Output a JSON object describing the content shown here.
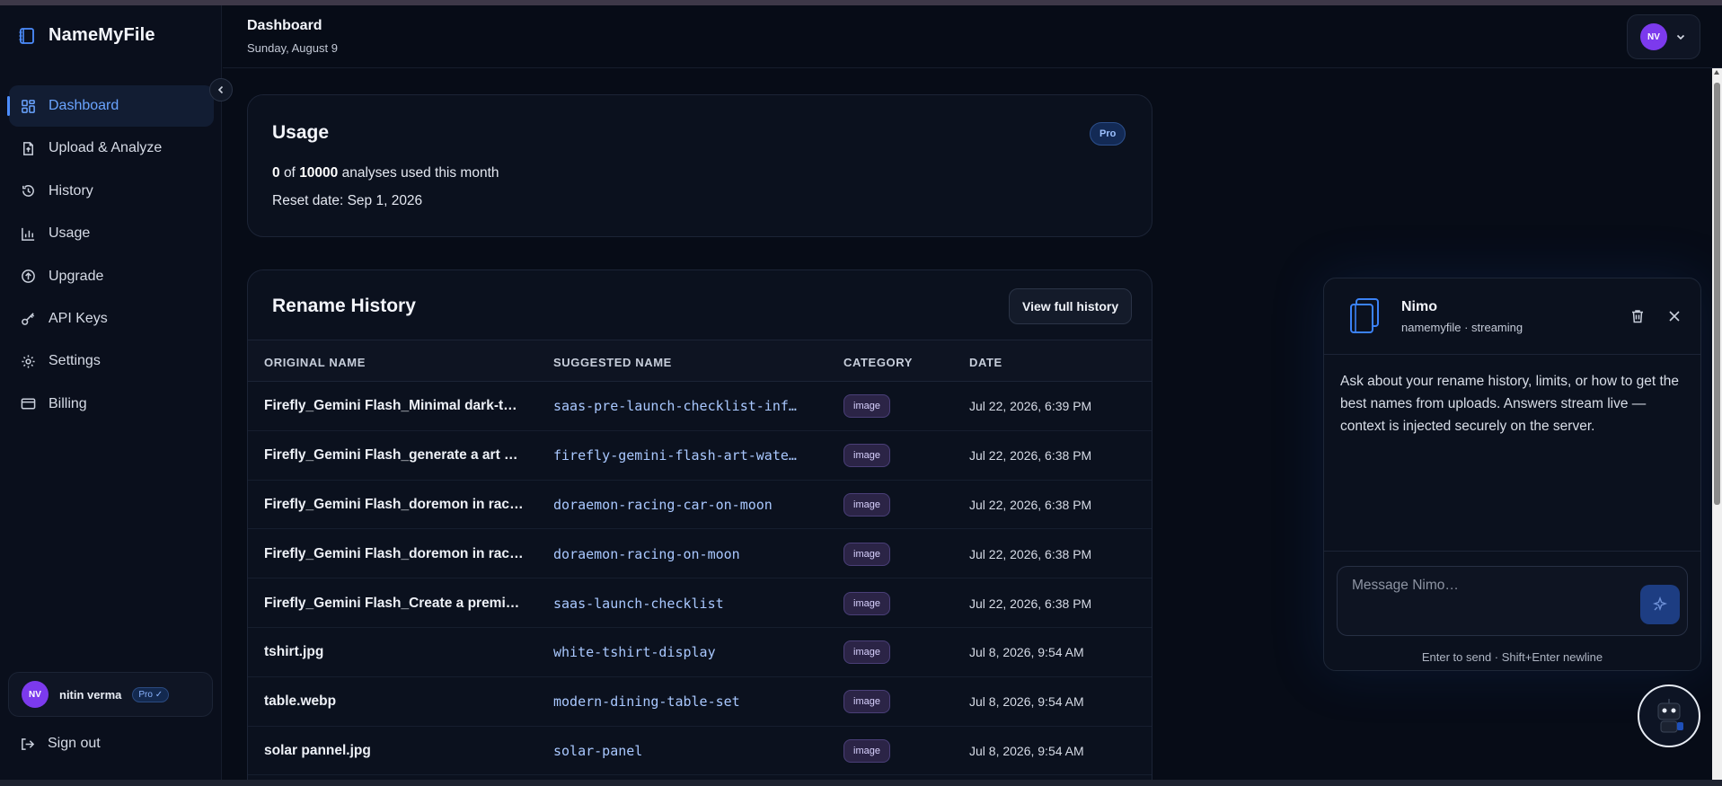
{
  "app": {
    "name": "NameMyFile"
  },
  "sidebar": {
    "items": [
      {
        "label": "Dashboard",
        "icon": "dashboard-icon",
        "active": true
      },
      {
        "label": "Upload & Analyze",
        "icon": "file-upload-icon"
      },
      {
        "label": "History",
        "icon": "history-icon"
      },
      {
        "label": "Usage",
        "icon": "bar-chart-icon"
      },
      {
        "label": "Upgrade",
        "icon": "arrow-up-circle-icon"
      },
      {
        "label": "API Keys",
        "icon": "key-icon"
      },
      {
        "label": "Settings",
        "icon": "gear-icon"
      },
      {
        "label": "Billing",
        "icon": "credit-card-icon"
      }
    ],
    "user": {
      "initials": "NV",
      "name": "nitin verma",
      "plan": "Pro ✓"
    },
    "signout_label": "Sign out"
  },
  "header": {
    "title": "Dashboard",
    "date": "Sunday, August 9",
    "account_initials": "NV"
  },
  "usage": {
    "title": "Usage",
    "badge": "Pro",
    "used": "0",
    "of_word": "of",
    "limit": "10000",
    "suffix": "analyses used this month",
    "reset": "Reset date: Sep 1, 2026"
  },
  "history": {
    "title": "Rename History",
    "view_button": "View full history",
    "columns": [
      "ORIGINAL NAME",
      "SUGGESTED NAME",
      "CATEGORY",
      "DATE"
    ],
    "rows": [
      {
        "original": "Firefly_Gemini Flash_Minimal dark-th…",
        "suggested": "saas-pre-launch-checklist-inf…",
        "category": "image",
        "date": "Jul 22, 2026, 6:39 PM"
      },
      {
        "original": "Firefly_Gemini Flash_generate a art …",
        "suggested": "firefly-gemini-flash-art-wate…",
        "category": "image",
        "date": "Jul 22, 2026, 6:38 PM"
      },
      {
        "original": "Firefly_Gemini Flash_doremon in raci…",
        "suggested": "doraemon-racing-car-on-moon",
        "category": "image",
        "date": "Jul 22, 2026, 6:38 PM"
      },
      {
        "original": "Firefly_Gemini Flash_doremon in raci…",
        "suggested": "doraemon-racing-on-moon",
        "category": "image",
        "date": "Jul 22, 2026, 6:38 PM"
      },
      {
        "original": "Firefly_Gemini Flash_Create a premiu…",
        "suggested": "saas-launch-checklist",
        "category": "image",
        "date": "Jul 22, 2026, 6:38 PM"
      },
      {
        "original": "tshirt.jpg",
        "suggested": "white-tshirt-display",
        "category": "image",
        "date": "Jul 8, 2026, 9:54 AM"
      },
      {
        "original": "table.webp",
        "suggested": "modern-dining-table-set",
        "category": "image",
        "date": "Jul 8, 2026, 9:54 AM"
      },
      {
        "original": "solar pannel.jpg",
        "suggested": "solar-panel",
        "category": "image",
        "date": "Jul 8, 2026, 9:54 AM"
      }
    ]
  },
  "chat": {
    "name": "Nimo",
    "subtitle": "namemyfile · streaming",
    "message": "Ask about your rename history, limits, or how to get the best names from uploads. Answers stream live — context is injected securely on the server.",
    "placeholder": "Message Nimo…",
    "hint": "Enter to send · Shift+Enter newline"
  },
  "colors": {
    "accent": "#4c8dff",
    "background": "#070c17",
    "card": "#0b111e",
    "avatar": "#7c3aed",
    "category_badge": "#2b2446"
  }
}
